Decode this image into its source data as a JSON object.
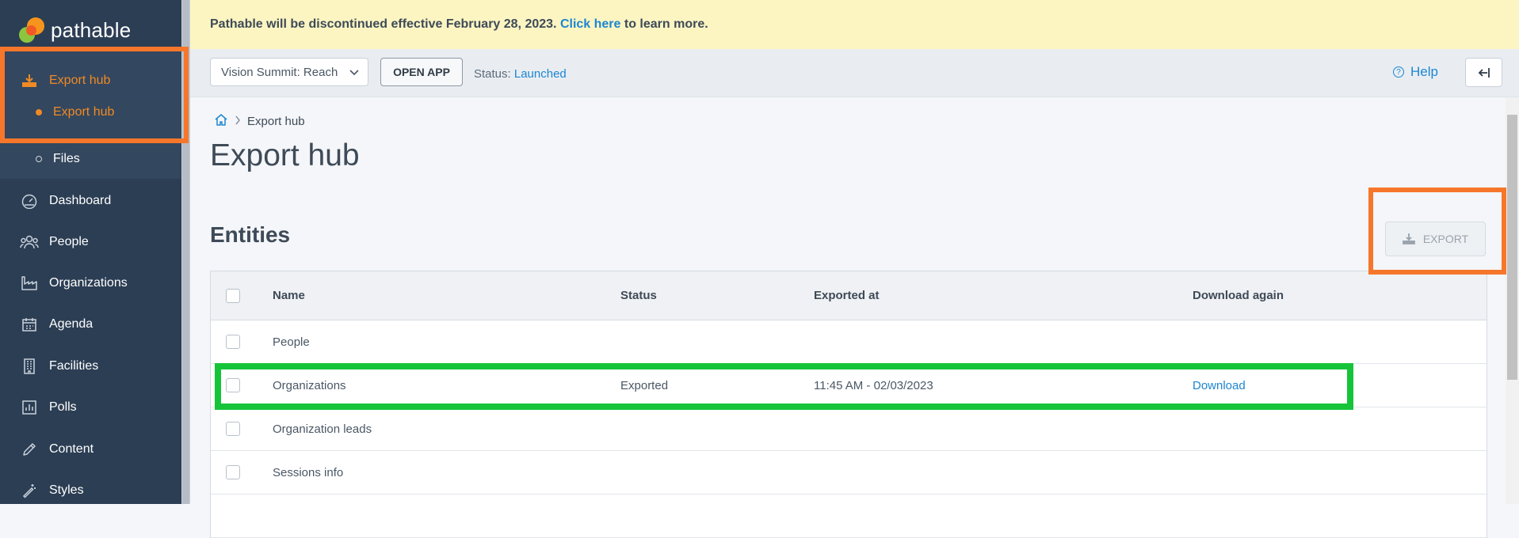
{
  "app": {
    "name": "pathable"
  },
  "banner": {
    "message": "Pathable will be discontinued effective February 28, 2023.",
    "link_text": "Click here",
    "suffix": "to learn more."
  },
  "toolbar": {
    "event_select": "Vision Summit: Reach",
    "open_app_label": "OPEN APP",
    "status_label": "Status:",
    "status_value": "Launched",
    "help_label": "Help"
  },
  "sidebar": {
    "items": [
      {
        "label": "Export hub",
        "icon": "download-icon",
        "active": true
      },
      {
        "label": "Dashboard",
        "icon": "gauge-icon"
      },
      {
        "label": "People",
        "icon": "people-icon"
      },
      {
        "label": "Organizations",
        "icon": "factory-icon"
      },
      {
        "label": "Agenda",
        "icon": "calendar-icon"
      },
      {
        "label": "Facilities",
        "icon": "building-icon"
      },
      {
        "label": "Polls",
        "icon": "bar-chart-icon"
      },
      {
        "label": "Content",
        "icon": "pencil-icon"
      },
      {
        "label": "Styles",
        "icon": "magic-wand-icon"
      }
    ],
    "subitems": [
      {
        "label": "Export hub",
        "active": true
      },
      {
        "label": "Files",
        "active": false
      }
    ]
  },
  "breadcrumb": {
    "current": "Export hub"
  },
  "page": {
    "title": "Export hub",
    "section_title": "Entities",
    "export_button": "EXPORT"
  },
  "table": {
    "columns": [
      "Name",
      "Status",
      "Exported at",
      "Download again"
    ],
    "rows": [
      {
        "name": "People",
        "status": "",
        "exported_at": "",
        "download": ""
      },
      {
        "name": "Organizations",
        "status": "Exported",
        "exported_at": "11:45 AM - 02/03/2023",
        "download": "Download"
      },
      {
        "name": "Organization leads",
        "status": "",
        "exported_at": "",
        "download": ""
      },
      {
        "name": "Sessions info",
        "status": "",
        "exported_at": "",
        "download": ""
      }
    ]
  },
  "colors": {
    "sidebar_bg": "#2c3e54",
    "accent_orange": "#f08a24",
    "link_blue": "#1c86d1",
    "banner_bg": "#fcf5c2",
    "highlight_orange": "#f6772b",
    "highlight_green": "#16c43a"
  }
}
